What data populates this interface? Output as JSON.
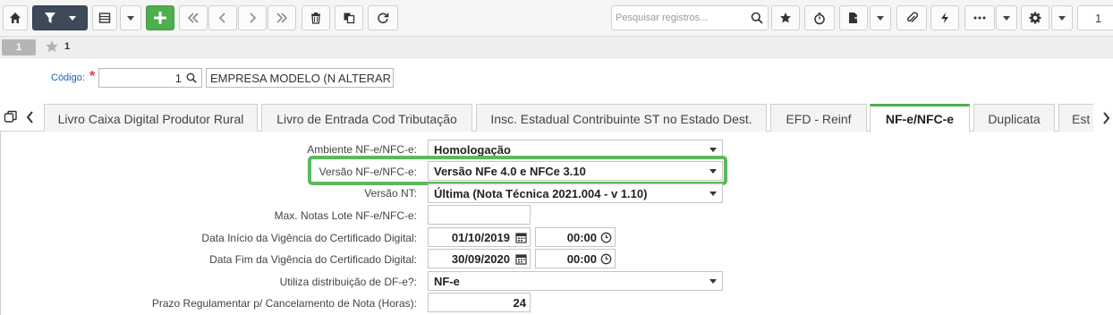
{
  "toolbar": {
    "search_placeholder": "Pesquisar registros...",
    "page_number": "1",
    "icons": [
      "home-icon",
      "filter-icon",
      "grid-icon",
      "plus-icon",
      "first-icon",
      "prev-icon",
      "next-icon",
      "last-icon",
      "trash-icon",
      "copy-icon",
      "refresh-icon",
      "search-icon",
      "star-icon",
      "timer-icon",
      "export-icon",
      "paperclip-icon",
      "lightning-icon",
      "more-icon",
      "gear-icon"
    ],
    "accent_color": "#4cae4c"
  },
  "record": {
    "badge": "1",
    "favorite_id": "1"
  },
  "codigo": {
    "label": "Código:",
    "required_mark": "*",
    "value": "1",
    "name_value": "EMPRESA MODELO (N ALTERAR"
  },
  "tabs": [
    {
      "label": "Livro Caixa Digital Produtor Rural"
    },
    {
      "label": "Livro de Entrada Cod Tributação"
    },
    {
      "label": "Insc. Estadual Contribuinte ST no Estado Dest."
    },
    {
      "label": "EFD - Reinf"
    },
    {
      "label": "NF-e/NFC-e"
    },
    {
      "label": "Duplicata"
    },
    {
      "label": "Est"
    }
  ],
  "active_tab": "NF-e/NFC-e",
  "form": {
    "ambiente": {
      "label": "Ambiente NF-e/NFC-e:",
      "value": "Homologação"
    },
    "versao": {
      "label": "Versão NF-e/NFC-e:",
      "value": "Versão NFe 4.0 e NFCe 3.10"
    },
    "versao_nt": {
      "label": "Versão NT:",
      "value": "Última (Nota Técnica 2021.004 - v 1.10)"
    },
    "max_notas": {
      "label": "Max. Notas Lote NF-e/NFC-e:",
      "value": ""
    },
    "inicio_vigencia": {
      "label": "Data Início da Vigência do Certificado Digital:",
      "date": "01/10/2019",
      "time": "00:00"
    },
    "fim_vigencia": {
      "label": "Data Fim da Vigência do Certificado Digital:",
      "date": "30/09/2020",
      "time": "00:00"
    },
    "utiliza_dfe": {
      "label": "Utiliza distribuição de DF-e?:",
      "value": "NF-e"
    },
    "prazo": {
      "label": "Prazo Regulamentar p/ Cancelamento de Nota (Horas):",
      "value": "24"
    }
  }
}
